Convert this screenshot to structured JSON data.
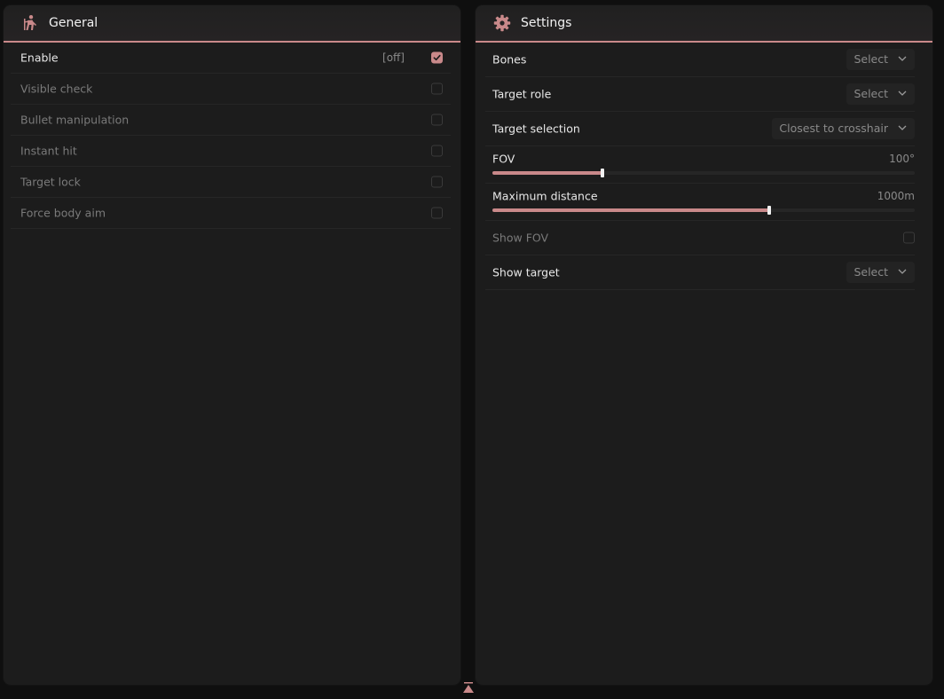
{
  "colors": {
    "accent": "#c9898a",
    "panel": "#1c1c1c",
    "text": "#e8e8e8",
    "muted": "#7a7a7a"
  },
  "general": {
    "title": "General",
    "icon": "figure-icon",
    "items": [
      {
        "label": "Enable",
        "bind": "[off]",
        "checked": true,
        "active": true
      },
      {
        "label": "Visible check",
        "checked": false,
        "active": false
      },
      {
        "label": "Bullet manipulation",
        "checked": false,
        "active": false
      },
      {
        "label": "Instant hit",
        "checked": false,
        "active": false
      },
      {
        "label": "Target lock",
        "checked": false,
        "active": false
      },
      {
        "label": "Force body aim",
        "checked": false,
        "active": false
      }
    ]
  },
  "settings": {
    "title": "Settings",
    "icon": "gear-icon",
    "bones": {
      "label": "Bones",
      "value": "Select"
    },
    "target_role": {
      "label": "Target role",
      "value": "Select"
    },
    "target_selection": {
      "label": "Target selection",
      "value": "Closest to crosshair"
    },
    "fov": {
      "label": "FOV",
      "value": "100°",
      "fraction": 0.26
    },
    "max_distance": {
      "label": "Maximum distance",
      "value": "1000m",
      "fraction": 0.655
    },
    "show_fov": {
      "label": "Show FOV",
      "checked": false
    },
    "show_target": {
      "label": "Show target",
      "value": "Select"
    }
  }
}
